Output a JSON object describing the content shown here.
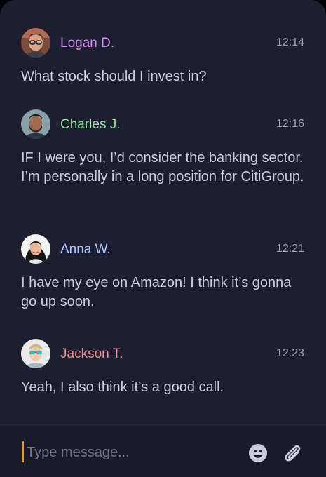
{
  "messages": [
    {
      "author": "Logan D.",
      "time": "12:14",
      "text": "What stock should I invest in?",
      "name_color": "#d68bf0",
      "avatar": "person-with-glasses"
    },
    {
      "author": "Charles J.",
      "time": "12:16",
      "text": "IF I were you, I’d consider the banking sector. I’m personally in a long position for CitiGroup.",
      "name_color": "#94e59d",
      "avatar": "man-with-beard"
    },
    {
      "author": "Anna W.",
      "time": "12:21",
      "text": "I have my eye on Amazon! I think it’s gonna go up soon.",
      "name_color": "#a8c6ff",
      "avatar": "woman-long-hair"
    },
    {
      "author": "Jackson T.",
      "time": "12:23",
      "text": "Yeah, I also think it’s a good call.",
      "name_color": "#f09090",
      "avatar": "man-with-sunglasses"
    }
  ],
  "composer": {
    "placeholder": "Type message...",
    "emoji_icon": "emoji-icon",
    "attach_icon": "paperclip-icon"
  }
}
